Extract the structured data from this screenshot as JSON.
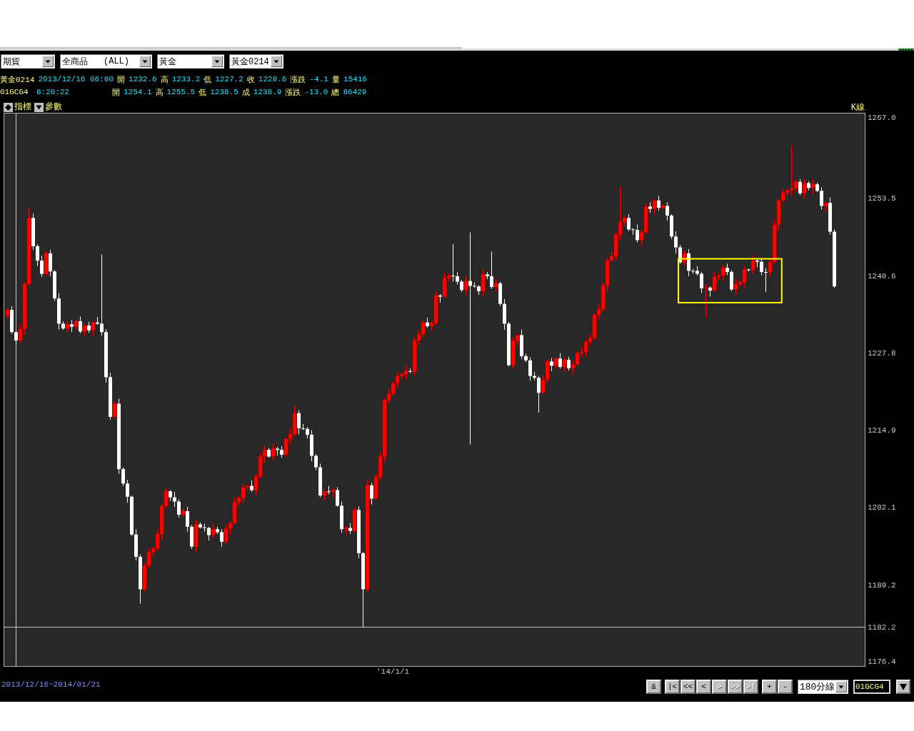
{
  "toolbar": {
    "dropdowns": [
      {
        "value": "期貨"
      },
      {
        "value": "全商品",
        "suffix": "(ALL)"
      },
      {
        "value": "黃金"
      },
      {
        "value": "黃金0214"
      }
    ]
  },
  "quote_lines": [
    {
      "symbol": "黃金0214",
      "time": "2013/12/16 06:00",
      "fields": [
        {
          "label": "開",
          "value": "1232.6"
        },
        {
          "label": "高",
          "value": "1233.2"
        },
        {
          "label": "低",
          "value": "1227.2"
        },
        {
          "label": "收",
          "value": "1228.6"
        },
        {
          "label": "漲跌",
          "value": "-4.1"
        },
        {
          "label": "量",
          "value": "15416"
        }
      ]
    },
    {
      "symbol": "01GCG4",
      "time": "8:20:22",
      "fields": [
        {
          "label": "開",
          "value": "1254.1"
        },
        {
          "label": "高",
          "value": "1255.5"
        },
        {
          "label": "低",
          "value": "1238.5"
        },
        {
          "label": "成",
          "value": "1238.9"
        },
        {
          "label": "漲跌",
          "value": "-13.0"
        },
        {
          "label": "總",
          "value": "86429"
        }
      ]
    }
  ],
  "chart": {
    "buttons": [
      {
        "kind": "indicators",
        "label": "指標"
      },
      {
        "kind": "parameters",
        "label": "參數"
      }
    ],
    "type_label": "K線",
    "cursor_label": "1182.2",
    "x_axis_label": "'14/1/1",
    "chart_data": {
      "type": "candlestick",
      "ylim": [
        1175.6,
        1267.8
      ],
      "yticks": [
        {
          "value": 1267.0,
          "label": "1267.0"
        },
        {
          "value": 1253.5,
          "label": "1253.5"
        },
        {
          "value": 1240.6,
          "label": "1240.6"
        },
        {
          "value": 1227.8,
          "label": "1227.8"
        },
        {
          "value": 1214.9,
          "label": "1214.9"
        },
        {
          "value": 1202.1,
          "label": "1202.1"
        },
        {
          "value": 1189.2,
          "label": "1189.2"
        },
        {
          "value": 1176.4,
          "label": "1176.4"
        }
      ],
      "ohlc": [
        [
          1234.0,
          1235.3,
          1233.5,
          1235.0
        ],
        [
          1235.0,
          1235.6,
          1231.0,
          1231.3
        ],
        [
          1231.3,
          1231.5,
          1229.1,
          1229.9
        ],
        [
          1229.9,
          1232.7,
          1229.5,
          1231.8
        ],
        [
          1231.8,
          1239.7,
          1230.8,
          1239.3
        ],
        [
          1239.3,
          1252.0,
          1239.1,
          1250.3
        ],
        [
          1250.3,
          1251.0,
          1245.0,
          1245.6
        ],
        [
          1245.6,
          1245.9,
          1242.3,
          1243.2
        ],
        [
          1243.2,
          1244.0,
          1240.5,
          1241.0
        ],
        [
          1241.0,
          1244.7,
          1240.7,
          1244.4
        ],
        [
          1244.4,
          1245.0,
          1240.6,
          1241.4
        ],
        [
          1241.4,
          1241.6,
          1236.5,
          1236.9
        ],
        [
          1236.9,
          1237.8,
          1231.7,
          1232.7
        ],
        [
          1232.7,
          1233.1,
          1231.7,
          1231.9
        ],
        [
          1231.9,
          1233.1,
          1231.3,
          1232.6
        ],
        [
          1232.6,
          1233.3,
          1231.3,
          1232.2
        ],
        [
          1232.2,
          1233.4,
          1231.7,
          1233.1
        ],
        [
          1233.1,
          1233.9,
          1231.1,
          1231.4
        ],
        [
          1231.4,
          1232.7,
          1230.6,
          1232.4
        ],
        [
          1232.4,
          1233.0,
          1231.2,
          1231.6
        ],
        [
          1231.6,
          1233.1,
          1230.6,
          1232.9
        ],
        [
          1232.9,
          1233.8,
          1232.5,
          1232.7
        ],
        [
          1232.7,
          1244.2,
          1230.7,
          1231.3
        ],
        [
          1231.3,
          1231.8,
          1222.9,
          1223.8
        ],
        [
          1223.8,
          1224.5,
          1216.7,
          1217.2
        ],
        [
          1217.2,
          1219.7,
          1216.9,
          1219.4
        ],
        [
          1219.4,
          1220.2,
          1207.7,
          1208.5
        ],
        [
          1208.5,
          1208.8,
          1205.7,
          1206.1
        ],
        [
          1206.1,
          1206.7,
          1202.9,
          1203.9
        ],
        [
          1203.9,
          1204.1,
          1197.4,
          1197.6
        ],
        [
          1197.6,
          1198.5,
          1193.3,
          1193.9
        ],
        [
          1193.9,
          1194.3,
          1186.1,
          1188.5
        ],
        [
          1188.5,
          1192.9,
          1188.0,
          1192.4
        ],
        [
          1192.4,
          1195.4,
          1192.1,
          1194.7
        ],
        [
          1194.7,
          1195.6,
          1193.9,
          1195.3
        ],
        [
          1195.3,
          1198.5,
          1194.9,
          1197.7
        ],
        [
          1197.7,
          1202.6,
          1196.7,
          1202.3
        ],
        [
          1202.3,
          1205.4,
          1202.1,
          1204.8
        ],
        [
          1204.8,
          1205.0,
          1203.2,
          1203.8
        ],
        [
          1203.8,
          1204.7,
          1202.2,
          1203.1
        ],
        [
          1203.1,
          1203.5,
          1200.4,
          1200.9
        ],
        [
          1200.9,
          1202.0,
          1200.6,
          1201.5
        ],
        [
          1201.5,
          1202.2,
          1198.1,
          1198.9
        ],
        [
          1198.9,
          1199.2,
          1195.2,
          1195.6
        ],
        [
          1195.6,
          1200.1,
          1194.6,
          1199.3
        ],
        [
          1199.3,
          1199.6,
          1198.6,
          1198.8
        ],
        [
          1198.8,
          1199.4,
          1198.1,
          1198.7
        ],
        [
          1198.7,
          1198.9,
          1196.6,
          1197.5
        ],
        [
          1197.5,
          1199.4,
          1197.0,
          1198.5
        ],
        [
          1198.5,
          1198.9,
          1197.7,
          1198.0
        ],
        [
          1198.0,
          1198.5,
          1195.6,
          1196.4
        ],
        [
          1196.4,
          1199.3,
          1196.0,
          1198.6
        ],
        [
          1198.6,
          1199.8,
          1197.6,
          1199.5
        ],
        [
          1199.5,
          1203.8,
          1199.3,
          1203.0
        ],
        [
          1203.0,
          1204.0,
          1202.4,
          1203.7
        ],
        [
          1203.7,
          1206.1,
          1202.8,
          1205.5
        ],
        [
          1205.5,
          1205.9,
          1205.0,
          1205.7
        ],
        [
          1205.7,
          1206.6,
          1204.7,
          1205.0
        ],
        [
          1205.0,
          1207.7,
          1204.2,
          1207.3
        ],
        [
          1207.3,
          1211.1,
          1206.9,
          1210.6
        ],
        [
          1210.6,
          1212.4,
          1209.6,
          1211.7
        ],
        [
          1211.7,
          1212.0,
          1210.4,
          1210.6
        ],
        [
          1210.6,
          1212.7,
          1210.0,
          1211.9
        ],
        [
          1211.9,
          1212.2,
          1210.8,
          1211.7
        ],
        [
          1211.7,
          1212.3,
          1210.4,
          1210.9
        ],
        [
          1210.9,
          1213.7,
          1210.6,
          1213.5
        ],
        [
          1213.5,
          1215.2,
          1212.7,
          1214.3
        ],
        [
          1214.3,
          1219.1,
          1213.9,
          1217.8
        ],
        [
          1217.8,
          1218.3,
          1214.3,
          1215.3
        ],
        [
          1215.3,
          1216.0,
          1215.0,
          1215.2
        ],
        [
          1215.2,
          1215.5,
          1213.6,
          1214.2
        ],
        [
          1214.2,
          1215.0,
          1209.8,
          1210.7
        ],
        [
          1210.7,
          1211.0,
          1208.3,
          1208.8
        ],
        [
          1208.8,
          1209.4,
          1203.8,
          1204.1
        ],
        [
          1204.1,
          1205.0,
          1203.3,
          1204.8
        ],
        [
          1204.8,
          1205.7,
          1204.3,
          1204.7
        ],
        [
          1204.7,
          1205.4,
          1203.7,
          1205.0
        ],
        [
          1205.0,
          1205.5,
          1202.2,
          1202.4
        ],
        [
          1202.4,
          1203.1,
          1197.9,
          1198.5
        ],
        [
          1198.5,
          1199.0,
          1197.6,
          1198.7
        ],
        [
          1198.7,
          1199.5,
          1197.7,
          1198.2
        ],
        [
          1198.2,
          1202.0,
          1197.9,
          1201.7
        ],
        [
          1201.7,
          1202.3,
          1193.7,
          1194.5
        ],
        [
          1194.5,
          1194.7,
          1182.2,
          1188.5
        ],
        [
          1188.5,
          1206.7,
          1188.1,
          1205.8
        ],
        [
          1205.8,
          1206.2,
          1202.6,
          1203.6
        ],
        [
          1203.6,
          1207.7,
          1203.4,
          1207.2
        ],
        [
          1207.2,
          1211.3,
          1206.6,
          1210.6
        ],
        [
          1210.6,
          1220.3,
          1209.7,
          1220.0
        ],
        [
          1220.0,
          1221.8,
          1219.5,
          1221.0
        ],
        [
          1221.0,
          1223.1,
          1220.7,
          1222.8
        ],
        [
          1222.8,
          1224.6,
          1222.0,
          1224.0
        ],
        [
          1224.0,
          1224.5,
          1223.6,
          1224.3
        ],
        [
          1224.3,
          1225.7,
          1223.3,
          1224.8
        ],
        [
          1224.8,
          1225.2,
          1224.5,
          1224.7
        ],
        [
          1224.7,
          1230.4,
          1224.1,
          1229.9
        ],
        [
          1229.9,
          1231.6,
          1229.0,
          1230.9
        ],
        [
          1230.9,
          1233.2,
          1230.4,
          1232.9
        ],
        [
          1232.9,
          1233.7,
          1232.0,
          1232.3
        ],
        [
          1232.3,
          1233.1,
          1231.5,
          1232.8
        ],
        [
          1232.8,
          1238.0,
          1232.4,
          1237.4
        ],
        [
          1237.4,
          1237.6,
          1236.2,
          1237.2
        ],
        [
          1237.2,
          1241.2,
          1237.0,
          1240.3
        ],
        [
          1240.3,
          1241.1,
          1239.7,
          1240.7
        ],
        [
          1240.7,
          1245.9,
          1239.7,
          1240.6
        ],
        [
          1240.6,
          1241.3,
          1239.2,
          1239.7
        ],
        [
          1239.7,
          1240.0,
          1238.0,
          1238.3
        ],
        [
          1238.3,
          1240.6,
          1237.5,
          1239.8
        ],
        [
          1239.8,
          1247.9,
          1212.6,
          1239.0
        ],
        [
          1239.0,
          1239.6,
          1238.7,
          1238.9
        ],
        [
          1238.9,
          1239.1,
          1237.5,
          1238.1
        ],
        [
          1238.1,
          1241.8,
          1237.2,
          1240.9
        ],
        [
          1240.9,
          1241.3,
          1240.1,
          1240.6
        ],
        [
          1240.6,
          1244.7,
          1238.5,
          1238.8
        ],
        [
          1238.8,
          1240.1,
          1238.0,
          1239.4
        ],
        [
          1239.4,
          1239.7,
          1235.6,
          1236.0
        ],
        [
          1236.0,
          1236.8,
          1231.7,
          1232.7
        ],
        [
          1232.7,
          1233.0,
          1225.6,
          1225.8
        ],
        [
          1225.8,
          1230.5,
          1225.2,
          1229.9
        ],
        [
          1229.9,
          1231.0,
          1229.0,
          1230.8
        ],
        [
          1230.8,
          1231.7,
          1226.8,
          1227.3
        ],
        [
          1227.3,
          1227.7,
          1226.3,
          1226.6
        ],
        [
          1226.6,
          1227.1,
          1223.2,
          1224.0
        ],
        [
          1224.0,
          1224.7,
          1223.3,
          1223.7
        ],
        [
          1223.7,
          1224.0,
          1217.9,
          1221.2
        ],
        [
          1221.2,
          1224.2,
          1221.0,
          1223.4
        ],
        [
          1223.4,
          1226.7,
          1222.8,
          1226.4
        ],
        [
          1226.4,
          1227.0,
          1224.8,
          1225.7
        ],
        [
          1225.7,
          1227.1,
          1225.2,
          1226.9
        ],
        [
          1226.9,
          1227.8,
          1225.2,
          1225.5
        ],
        [
          1225.5,
          1227.1,
          1224.7,
          1226.7
        ],
        [
          1226.7,
          1227.2,
          1224.9,
          1225.3
        ],
        [
          1225.3,
          1226.6,
          1224.3,
          1225.9
        ],
        [
          1225.9,
          1228.1,
          1225.7,
          1227.8
        ],
        [
          1227.8,
          1228.8,
          1227.2,
          1228.0
        ],
        [
          1228.0,
          1230.0,
          1227.1,
          1229.7
        ],
        [
          1229.7,
          1230.9,
          1229.2,
          1230.3
        ],
        [
          1230.3,
          1234.4,
          1230.0,
          1234.2
        ],
        [
          1234.2,
          1236.0,
          1233.4,
          1235.1
        ],
        [
          1235.1,
          1239.5,
          1234.7,
          1239.1
        ],
        [
          1239.1,
          1243.7,
          1238.1,
          1243.2
        ],
        [
          1243.2,
          1244.6,
          1243.0,
          1243.9
        ],
        [
          1243.9,
          1247.8,
          1243.3,
          1247.5
        ],
        [
          1247.5,
          1255.5,
          1246.6,
          1249.6
        ],
        [
          1249.6,
          1250.6,
          1249.1,
          1250.3
        ],
        [
          1250.3,
          1250.9,
          1248.1,
          1248.4
        ],
        [
          1248.4,
          1248.6,
          1247.5,
          1248.3
        ],
        [
          1248.3,
          1249.2,
          1246.2,
          1246.6
        ],
        [
          1246.6,
          1248.3,
          1245.6,
          1247.9
        ],
        [
          1247.9,
          1252.7,
          1247.7,
          1252.2
        ],
        [
          1252.2,
          1252.9,
          1251.2,
          1251.8
        ],
        [
          1251.8,
          1253.5,
          1250.9,
          1253.2
        ],
        [
          1253.2,
          1254.0,
          1251.5,
          1252.0
        ],
        [
          1252.0,
          1252.6,
          1251.7,
          1252.3
        ],
        [
          1252.3,
          1252.9,
          1249.9,
          1250.7
        ],
        [
          1250.7,
          1250.9,
          1246.8,
          1247.2
        ],
        [
          1247.2,
          1248.1,
          1244.4,
          1245.4
        ],
        [
          1245.4,
          1245.8,
          1242.7,
          1242.9
        ],
        [
          1242.9,
          1244.9,
          1242.3,
          1244.4
        ],
        [
          1244.4,
          1245.1,
          1240.6,
          1241.5
        ],
        [
          1241.5,
          1241.8,
          1241.0,
          1241.5
        ],
        [
          1241.5,
          1242.3,
          1240.7,
          1241.0
        ],
        [
          1241.0,
          1241.3,
          1237.8,
          1238.6
        ],
        [
          1238.6,
          1239.3,
          1233.7,
          1238.7
        ],
        [
          1238.7,
          1238.9,
          1237.2,
          1238.2
        ],
        [
          1238.2,
          1241.4,
          1238.0,
          1240.5
        ],
        [
          1240.5,
          1241.1,
          1239.9,
          1240.7
        ],
        [
          1240.7,
          1242.5,
          1239.8,
          1242.0
        ],
        [
          1242.0,
          1242.7,
          1240.8,
          1241.3
        ],
        [
          1241.3,
          1241.6,
          1238.1,
          1238.4
        ],
        [
          1238.4,
          1240.1,
          1237.6,
          1239.3
        ],
        [
          1239.3,
          1239.9,
          1238.9,
          1239.6
        ],
        [
          1239.6,
          1242.3,
          1238.6,
          1241.7
        ],
        [
          1241.7,
          1241.9,
          1241.4,
          1241.6
        ],
        [
          1241.6,
          1244.1,
          1241.0,
          1243.2
        ],
        [
          1243.2,
          1243.6,
          1242.1,
          1243.0
        ],
        [
          1243.0,
          1243.5,
          1240.8,
          1241.3
        ],
        [
          1241.3,
          1242.0,
          1238.0,
          1241.3
        ],
        [
          1241.3,
          1243.3,
          1240.5,
          1243.0
        ],
        [
          1243.0,
          1250.0,
          1242.6,
          1249.2
        ],
        [
          1249.2,
          1253.5,
          1248.2,
          1253.2
        ],
        [
          1253.2,
          1255.1,
          1253.0,
          1254.5
        ],
        [
          1254.5,
          1255.1,
          1253.9,
          1254.9
        ],
        [
          1254.9,
          1262.3,
          1254.0,
          1255.2
        ],
        [
          1255.2,
          1256.7,
          1254.7,
          1256.3
        ],
        [
          1256.3,
          1256.8,
          1254.1,
          1254.4
        ],
        [
          1254.4,
          1256.8,
          1253.6,
          1256.1
        ],
        [
          1256.1,
          1256.4,
          1254.9,
          1255.3
        ],
        [
          1255.3,
          1256.7,
          1254.3,
          1255.9
        ],
        [
          1255.9,
          1256.2,
          1254.6,
          1254.8
        ],
        [
          1254.8,
          1255.4,
          1251.7,
          1252.3
        ],
        [
          1252.3,
          1253.0,
          1251.4,
          1252.8
        ],
        [
          1252.8,
          1253.7,
          1247.5,
          1248.0
        ],
        [
          1248.0,
          1248.4,
          1238.6,
          1238.9
        ]
      ]
    }
  },
  "status_bar": {
    "date_range": "2013/12/16~2014/01/21",
    "button_groups": [
      {
        "buttons": [
          {
            "label": "&",
            "disabled": false
          }
        ]
      },
      {
        "buttons": [
          {
            "label": "|<",
            "disabled": false
          },
          {
            "label": "<<",
            "disabled": false
          },
          {
            "label": "<",
            "disabled": false
          },
          {
            "label": ">",
            "disabled": true
          },
          {
            "label": ">>",
            "disabled": true
          },
          {
            "label": ">|",
            "disabled": true
          }
        ]
      },
      {
        "buttons": [
          {
            "label": "+",
            "disabled": false
          },
          {
            "label": "-",
            "disabled": false
          }
        ]
      }
    ],
    "period_dropdown": {
      "value": "180分線"
    },
    "symbol_field": {
      "value": "01GCG4"
    }
  }
}
